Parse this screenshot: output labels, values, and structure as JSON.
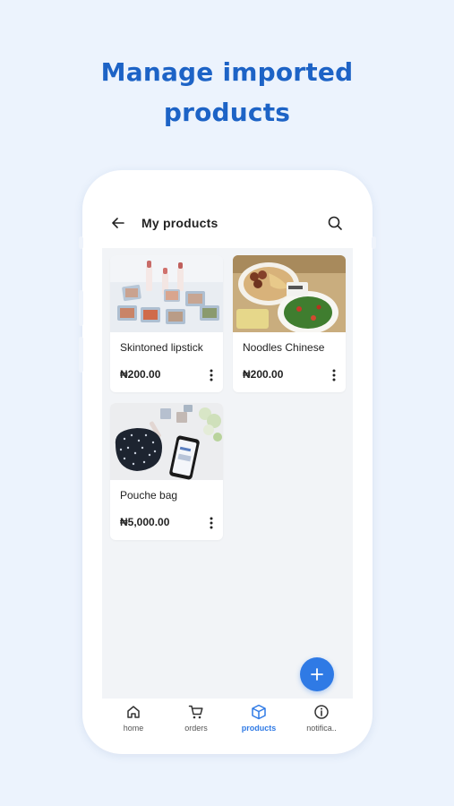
{
  "headline": {
    "line1": "Manage imported",
    "line2": "products"
  },
  "appbar": {
    "title": "My products",
    "back_icon": "arrow-left-icon",
    "search_icon": "search-icon"
  },
  "products": [
    {
      "name": "Skintoned lipstick",
      "price": "₦200.00",
      "image": "lipstick-and-eyeshadow-photo"
    },
    {
      "name": "Noodles Chinese",
      "price": "₦200.00",
      "image": "noodles-dish-photo"
    },
    {
      "name": "Pouche bag",
      "price": "₦5,000.00",
      "image": "pouch-bag-and-phone-photo"
    }
  ],
  "fab": {
    "icon": "plus-icon"
  },
  "bottom_nav": [
    {
      "label": "home",
      "icon": "home-icon",
      "active": false
    },
    {
      "label": "orders",
      "icon": "cart-icon",
      "active": false
    },
    {
      "label": "products",
      "icon": "box-icon",
      "active": true
    },
    {
      "label": "notifica..",
      "icon": "info-icon",
      "active": false
    }
  ],
  "colors": {
    "background": "#ecf3fd",
    "headline": "#1d63c6",
    "accent": "#2f7ae5",
    "content_bg": "#f2f4f7"
  }
}
